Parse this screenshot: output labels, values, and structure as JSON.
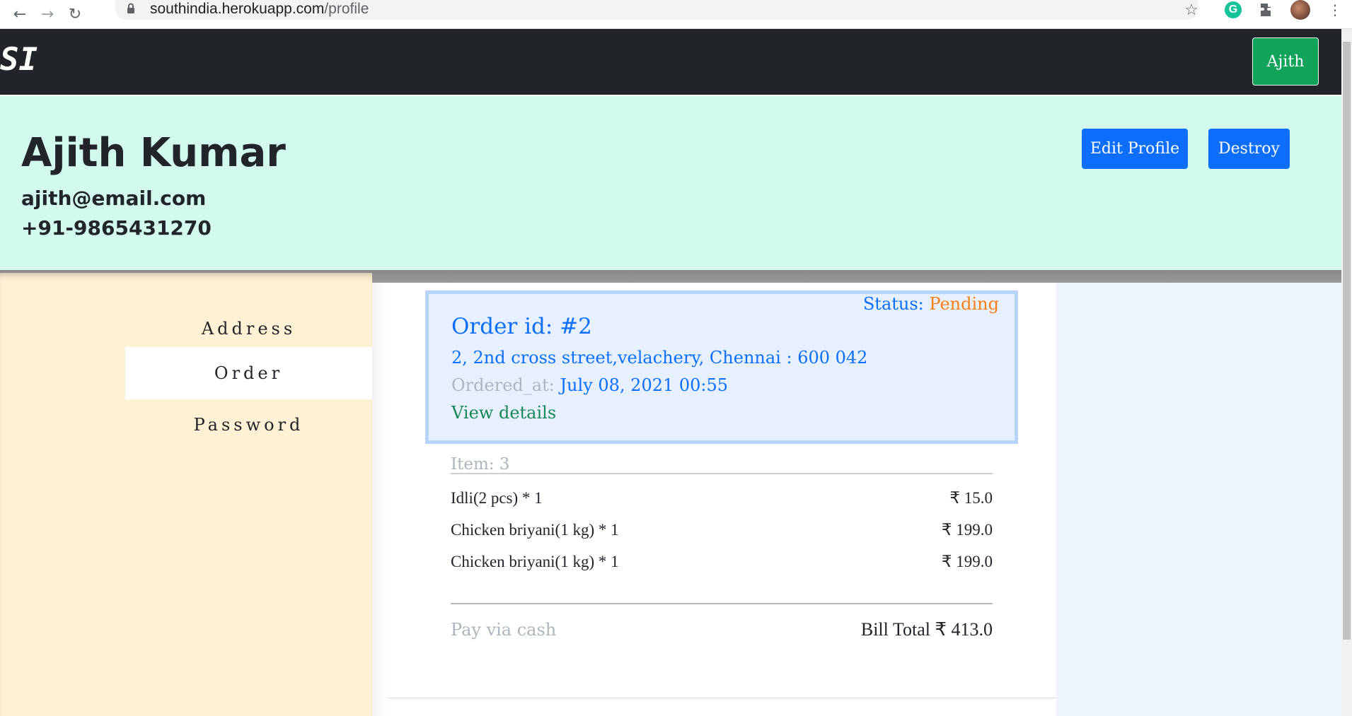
{
  "browser": {
    "url_host": "southindia.herokuapp.com",
    "url_path": "/profile",
    "icons": [
      "back-arrow-icon",
      "forward-arrow-icon",
      "reload-icon",
      "lock-icon",
      "star-icon",
      "grammarly-icon",
      "extensions-icon",
      "avatar",
      "kebab-menu-icon"
    ]
  },
  "navbar": {
    "brand": "SI",
    "user_button": "Ajith"
  },
  "profile": {
    "name": "Ajith Kumar",
    "email": "ajith@email.com",
    "phone": "+91-9865431270",
    "edit_label": "Edit Profile",
    "destroy_label": "Destroy"
  },
  "sidebar": {
    "items": [
      {
        "label": "Address"
      },
      {
        "label": "Order"
      },
      {
        "label": "Password"
      }
    ],
    "active": "Order"
  },
  "order": {
    "status_label": "Status:",
    "status_value": "Pending",
    "id_text": "Order id: #2",
    "address": "2, 2nd cross street,velachery, Chennai : 600 042",
    "ordered_at_label": "Ordered_at:",
    "ordered_at_value": "July 08, 2021 00:55",
    "view_details": "View details",
    "item_count": "Item: 3",
    "items": [
      {
        "name": "Idli(2 pcs) * 1",
        "price": "₹ 15.0"
      },
      {
        "name": "Chicken briyani(1 kg) * 1",
        "price": "₹ 199.0"
      },
      {
        "name": "Chicken briyani(1 kg) * 1",
        "price": "₹ 199.0"
      }
    ],
    "payment": "Pay via cash",
    "bill_total": "Bill Total ₹ 413.0"
  },
  "colors": {
    "navbar": "#212529",
    "header": "#d2fbed",
    "sidebar": "#fff1d3",
    "primary": "#0d6efd",
    "success": "#10a35a",
    "pending": "#fd7e14"
  }
}
